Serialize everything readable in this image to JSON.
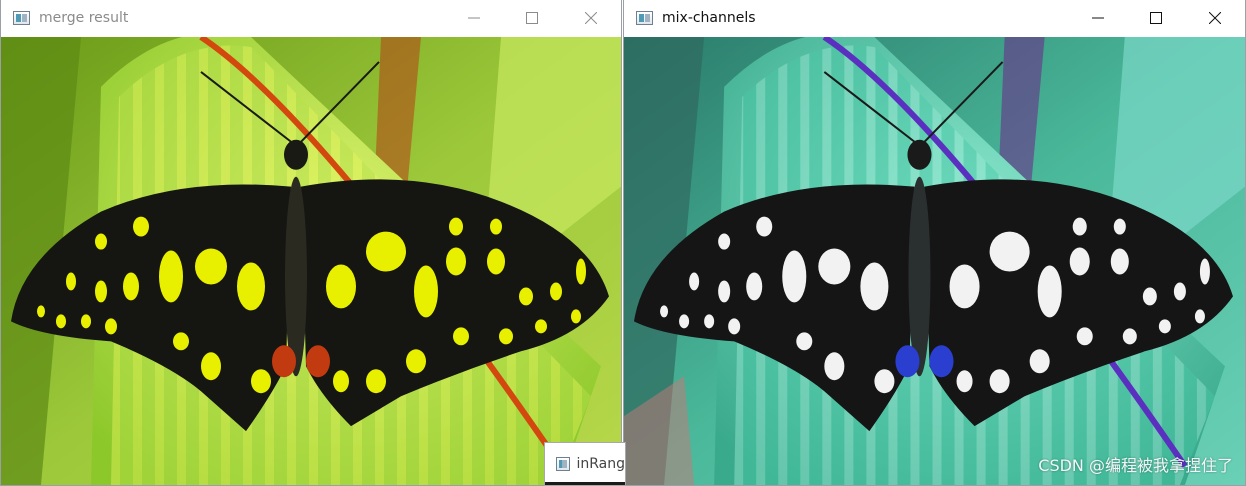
{
  "windows": {
    "left": {
      "title": "merge result"
    },
    "right": {
      "title": "mix-channels"
    },
    "background": {
      "title_partial": "inRang"
    }
  },
  "icons": {
    "app": "opencv-window-icon",
    "minimize": "minimize-icon",
    "maximize": "maximize-icon",
    "close": "close-icon"
  },
  "watermark": "CSDN @编程被我拿捏住了",
  "colors": {
    "left_wing_spots": "#e8f000",
    "left_leaf": "#a8d83a",
    "left_stripe": "#d04a10",
    "right_wing_spots": "#f2f2f2",
    "right_leaf": "#4fd8b5",
    "right_stripe": "#5b2fbf",
    "wing_black": "#151512"
  }
}
